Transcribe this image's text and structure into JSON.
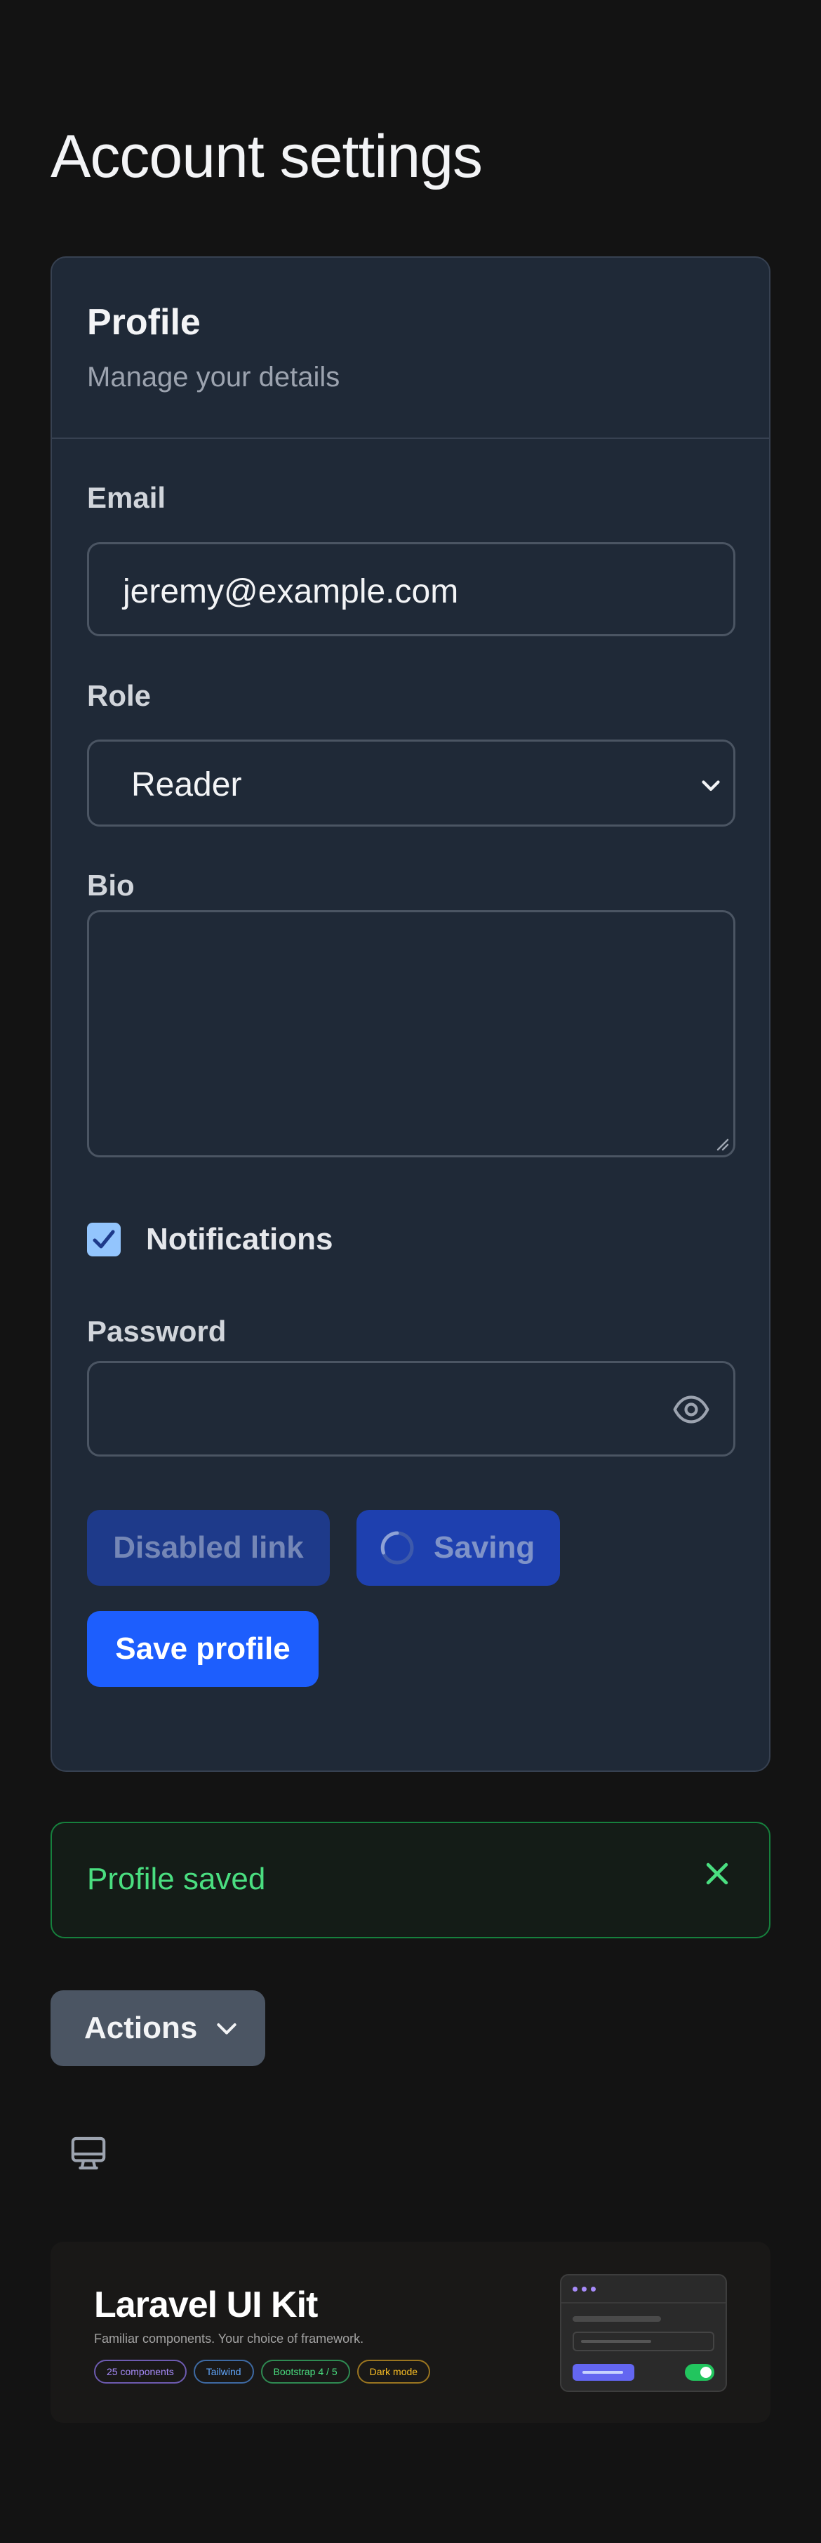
{
  "page": {
    "title": "Account settings"
  },
  "profile": {
    "title": "Profile",
    "subtitle": "Manage your details",
    "email": {
      "label": "Email",
      "value": "jeremy@example.com"
    },
    "role": {
      "label": "Role",
      "selected": "Reader"
    },
    "bio": {
      "label": "Bio",
      "value": ""
    },
    "notifications": {
      "label": "Notifications",
      "checked": true
    },
    "password": {
      "label": "Password",
      "value": ""
    },
    "buttons": {
      "disabled_link": "Disabled link",
      "saving": "Saving",
      "save": "Save profile"
    }
  },
  "alert": {
    "message": "Profile saved",
    "status_color": "#4ade80"
  },
  "actions": {
    "label": "Actions"
  },
  "banner": {
    "title": "Laravel UI Kit",
    "subtitle": "Familiar components. Your choice of framework.",
    "tags": [
      {
        "label": "25 components",
        "color": "#a78bfa"
      },
      {
        "label": "Tailwind",
        "color": "#60a5fa"
      },
      {
        "label": "Bootstrap 4 / 5",
        "color": "#4ade80"
      },
      {
        "label": "Dark mode",
        "color": "#fbbf24"
      }
    ]
  },
  "colors": {
    "accent": "#1d5efd",
    "card_bg": "#1f2937",
    "page_bg": "#131313",
    "success": "#16803d"
  },
  "icons": {
    "role_select": "chevron-down-icon",
    "textarea_resize": "resize-handle-icon",
    "password_toggle": "eye-icon",
    "saving": "spinner-icon",
    "alert_close": "close-icon",
    "actions": "chevron-down-icon",
    "theme": "monitor-icon"
  }
}
